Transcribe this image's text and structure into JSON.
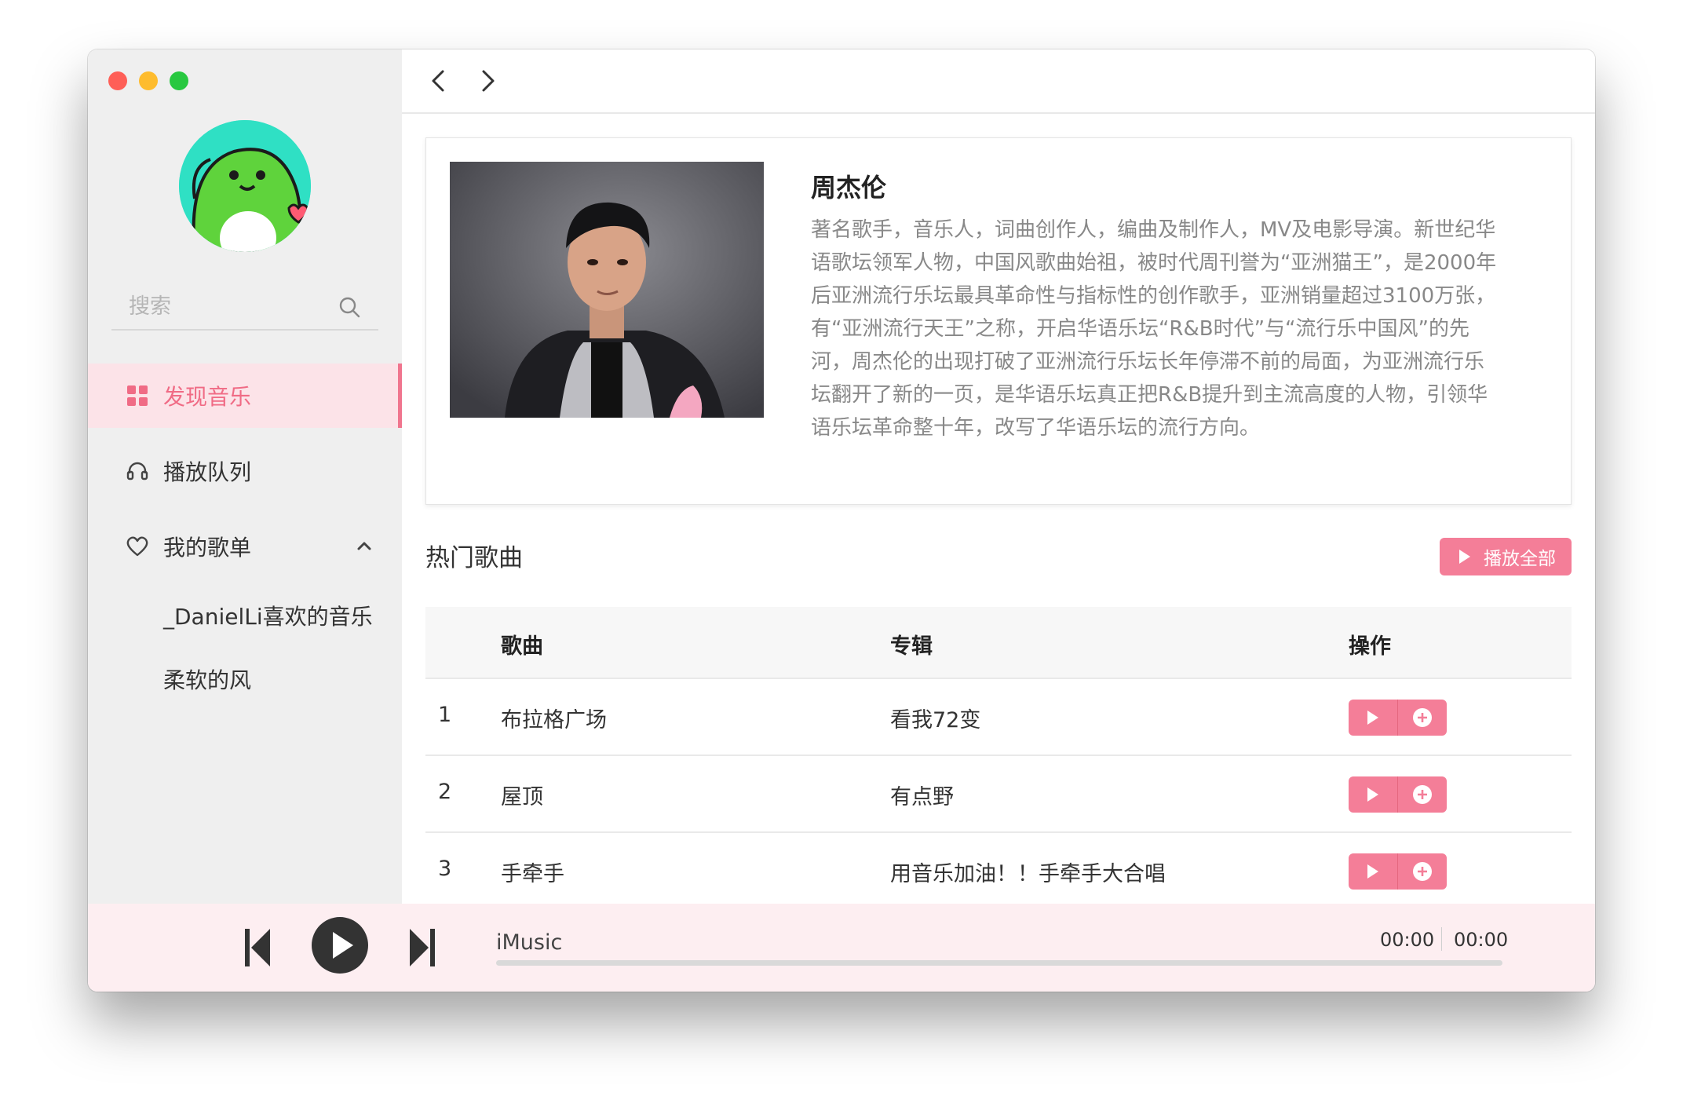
{
  "colors": {
    "accent": "#f47e98",
    "accent_text": "#f06b85",
    "sidebar_bg": "#efefef",
    "player_bg": "#fdeef1",
    "traffic_red": "#fe5f57",
    "traffic_yellow": "#febc2e",
    "traffic_green": "#28c840"
  },
  "sidebar": {
    "search_placeholder": "搜索",
    "nav": [
      {
        "label": "发现音乐",
        "icon": "grid-icon",
        "active": true
      },
      {
        "label": "播放队列",
        "icon": "headphones-icon",
        "active": false
      },
      {
        "label": "我的歌单",
        "icon": "heart-icon",
        "active": false,
        "expanded": true
      }
    ],
    "playlists": [
      "_DanielLi喜欢的音乐",
      "柔软的风"
    ]
  },
  "artist": {
    "name": "周杰伦",
    "bio": "著名歌手，音乐人，词曲创作人，编曲及制作人，MV及电影导演。新世纪华语歌坛领军人物，中国风歌曲始祖，被时代周刊誉为“亚洲猫王”，是2000年后亚洲流行乐坛最具革命性与指标性的创作歌手，亚洲销量超过3100万张，有“亚洲流行天王”之称，开启华语乐坛“R&B时代”与“流行乐中国风”的先河，周杰伦的出现打破了亚洲流行乐坛长年停滞不前的局面，为亚洲流行乐坛翻开了新的一页，是华语乐坛真正把R&B提升到主流高度的人物，引领华语乐坛革命整十年，改写了华语乐坛的流行方向。"
  },
  "hot_songs": {
    "title": "热门歌曲",
    "play_all_label": "播放全部",
    "columns": [
      "歌曲",
      "专辑",
      "操作"
    ],
    "rows": [
      {
        "index": "1",
        "song": "布拉格广场",
        "album": "看我72变"
      },
      {
        "index": "2",
        "song": "屋顶",
        "album": "有点野"
      },
      {
        "index": "3",
        "song": "手牵手",
        "album": "用音乐加油！！手牵手大合唱"
      }
    ]
  },
  "player": {
    "track_title": "iMusic",
    "current_time": "00:00",
    "total_time": "00:00",
    "progress": 0
  }
}
